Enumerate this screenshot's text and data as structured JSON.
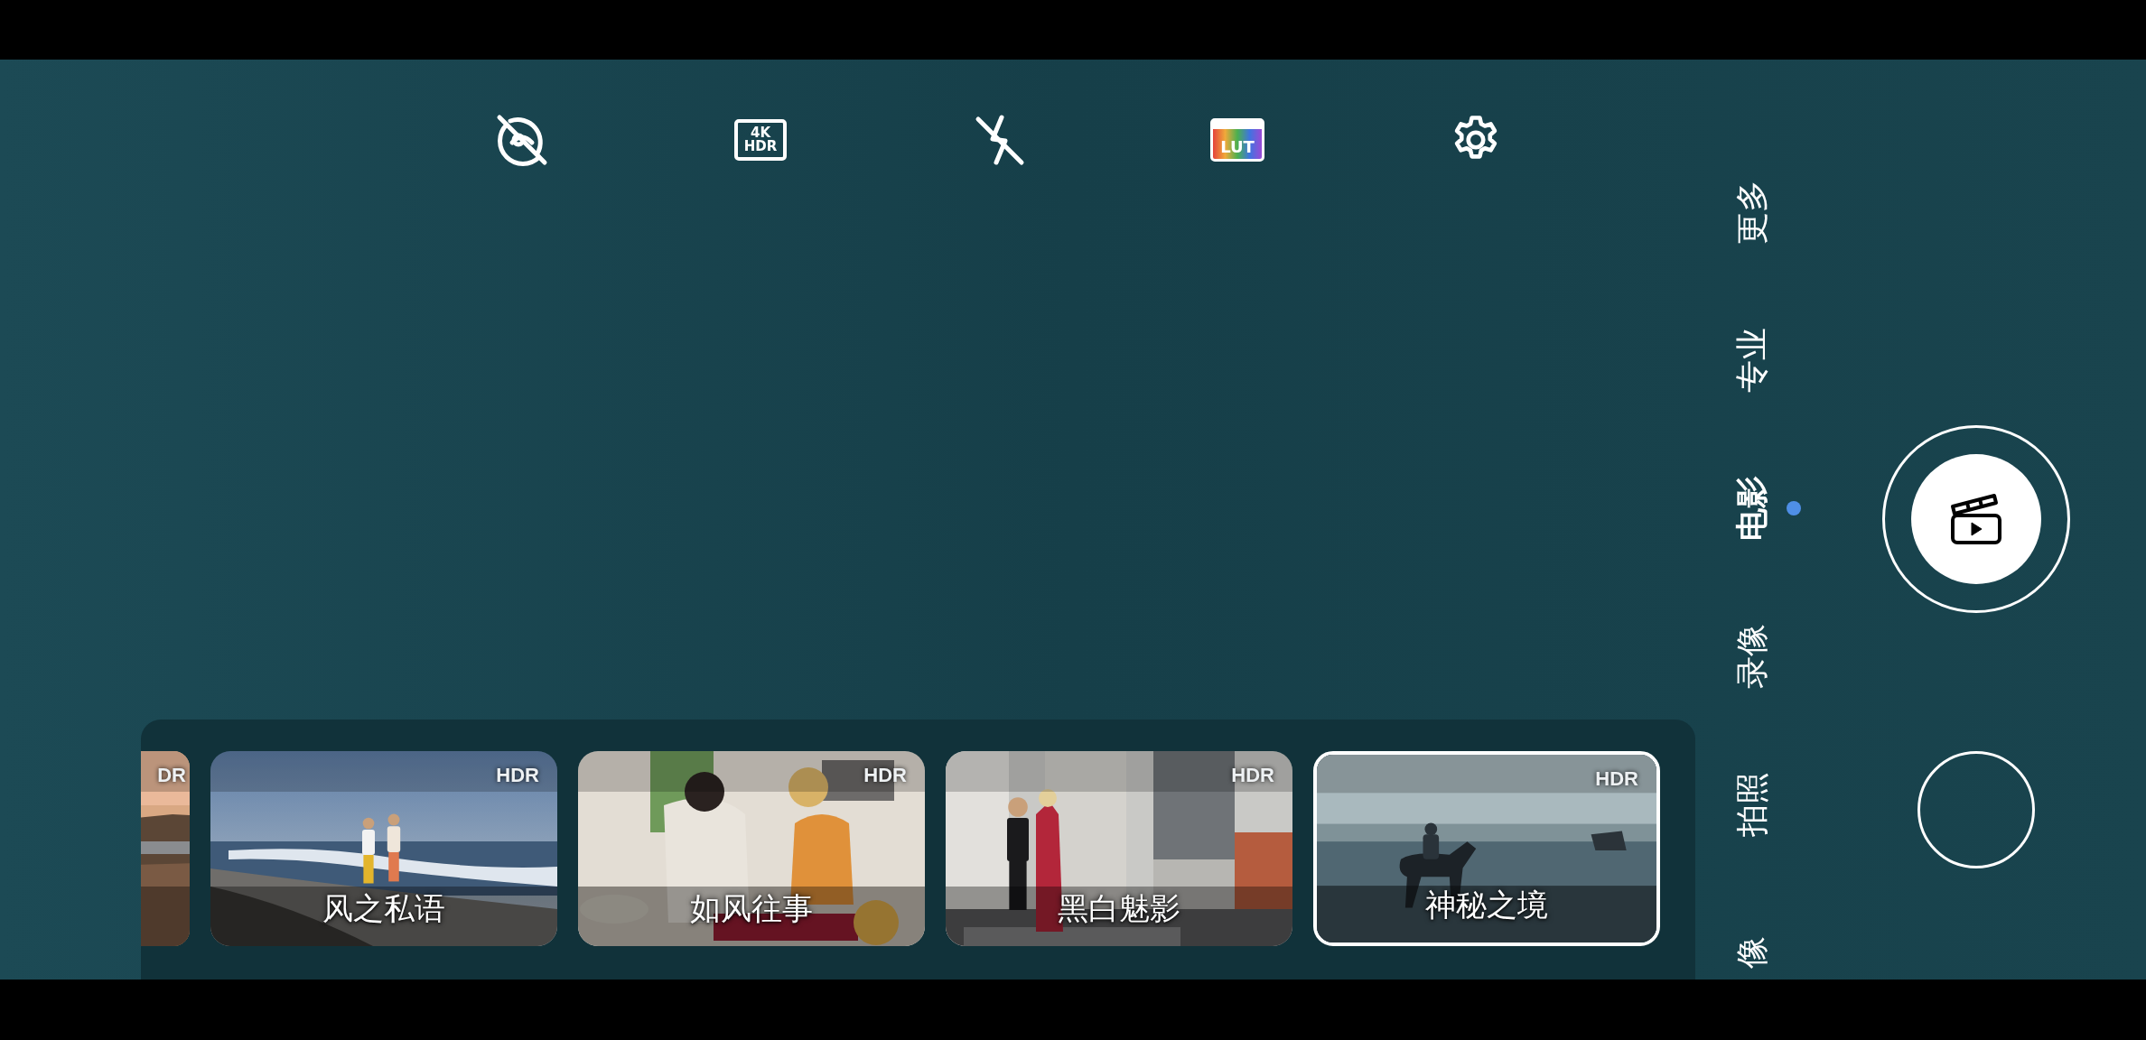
{
  "toolbar": {
    "quality_lines": [
      "4K",
      "HDR"
    ],
    "lut_label": "LUT"
  },
  "filters": [
    {
      "kind": "picture",
      "badge": "DR",
      "selected": false,
      "partial": true
    },
    {
      "kind": "picture",
      "title": "风之私语",
      "badge": "HDR",
      "selected": false
    },
    {
      "kind": "picture",
      "title": "如风往事",
      "badge": "HDR",
      "selected": false
    },
    {
      "kind": "picture",
      "title": "黑白魅影",
      "badge": "HDR",
      "selected": false
    },
    {
      "kind": "picture",
      "title": "神秘之境",
      "badge": "HDR",
      "selected": true
    }
  ],
  "modes": [
    {
      "label": "更多",
      "selected": false
    },
    {
      "label": "专业",
      "selected": false
    },
    {
      "label": "电影",
      "selected": true
    },
    {
      "label": "录像",
      "selected": false
    },
    {
      "label": "拍照",
      "selected": false
    },
    {
      "label": "像",
      "selected": false
    }
  ]
}
